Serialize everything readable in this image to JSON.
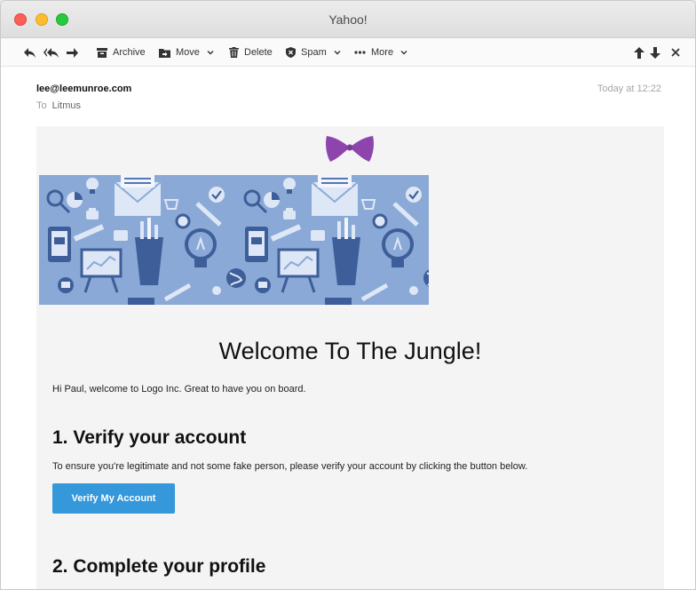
{
  "window": {
    "title": "Yahoo!"
  },
  "toolbar": {
    "archive_label": "Archive",
    "move_label": "Move",
    "delete_label": "Delete",
    "spam_label": "Spam",
    "more_label": "More"
  },
  "message": {
    "from": "lee@leemunroe.com",
    "to_prefix": "To",
    "to": "Litmus",
    "date": "Today at 12:22"
  },
  "email": {
    "heading": "Welcome To The Jungle!",
    "greeting": "Hi Paul, welcome to Logo Inc. Great to have you on board.",
    "step1_title": "1. Verify your account",
    "step1_text": "To ensure you're legitimate and not some fake person, please verify your account by clicking the button below.",
    "verify_button": "Verify My Account",
    "step2_title": "2. Complete your profile"
  },
  "colors": {
    "accent": "#3498db",
    "logo": "#8e44ad",
    "hero_bg": "#8ba9d7",
    "body_bg": "#f4f4f4"
  },
  "icons": [
    "reply-icon",
    "reply-all-icon",
    "forward-icon",
    "archive-icon",
    "move-icon",
    "delete-icon",
    "spam-icon",
    "more-icon",
    "arrow-up-icon",
    "arrow-down-icon",
    "close-icon",
    "bowtie-logo"
  ]
}
